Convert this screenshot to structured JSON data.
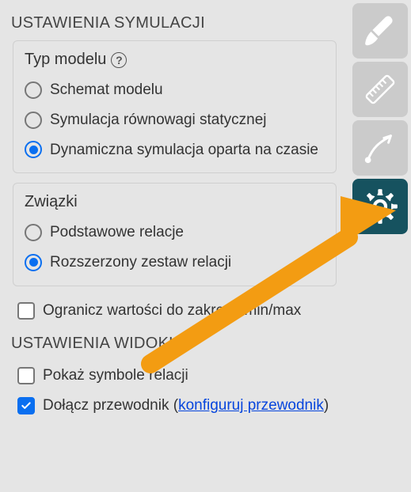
{
  "sections": {
    "sim_title": "USTAWIENIA SYMULACJI",
    "view_title": "USTAWIENIA WIDOKU"
  },
  "model_type": {
    "title": "Typ modelu",
    "options": {
      "diagram": "Schemat modelu",
      "static": "Symulacja równowagi statycznej",
      "dynamic": "Dynamiczna symulacja oparta na czasie"
    },
    "selected": "dynamic"
  },
  "relations": {
    "title": "Związki",
    "options": {
      "basic": "Podstawowe relacje",
      "extended": "Rozszerzony zestaw relacji"
    },
    "selected": "extended"
  },
  "limit_range": {
    "label": "Ogranicz wartości do zakresu min/max",
    "checked": false
  },
  "view": {
    "show_symbols": {
      "label": "Pokaż symbole relacji",
      "checked": false
    },
    "include_guide": {
      "prefix": "Dołącz przewodnik (",
      "link": "konfiguruj przewodnik",
      "suffix": ")",
      "checked": true
    }
  },
  "sidebar": {
    "brush": "brush-tool",
    "ruler": "ruler-tool",
    "curve": "curve-tool",
    "settings": "settings-tool"
  },
  "colors": {
    "accent": "#0a6ff0",
    "tool_active_bg": "#16525f",
    "tool_inactive_bg": "#cbcbcb",
    "arrow": "#f39c12"
  }
}
